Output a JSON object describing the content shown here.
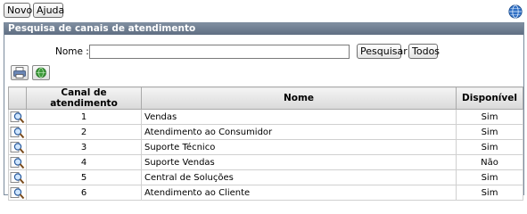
{
  "toolbar": {
    "novo_label": "Novo",
    "ajuda_label": "Ajuda"
  },
  "panel": {
    "title": "Pesquisa de canais de atendimento",
    "search": {
      "nome_label": "Nome :",
      "nome_value": "",
      "pesquisar_label": "Pesquisar",
      "todos_label": "Todos"
    }
  },
  "icons": {
    "help": "globe-help-icon",
    "print": "print-icon",
    "export": "export-icon",
    "row": "magnifier-icon"
  },
  "colors": {
    "panel_header": "#6c7b8e",
    "table_header": "#e3e3e3"
  },
  "table": {
    "columns": [
      "",
      "Canal de atendimento",
      "Nome",
      "Disponível"
    ],
    "rows": [
      {
        "id": "1",
        "nome": "Vendas",
        "disponivel": "Sim"
      },
      {
        "id": "2",
        "nome": "Atendimento ao Consumidor",
        "disponivel": "Sim"
      },
      {
        "id": "3",
        "nome": "Suporte Técnico",
        "disponivel": "Sim"
      },
      {
        "id": "4",
        "nome": "Suporte Vendas",
        "disponivel": "Não"
      },
      {
        "id": "5",
        "nome": "Central de Soluções",
        "disponivel": "Sim"
      },
      {
        "id": "6",
        "nome": "Atendimento ao Cliente",
        "disponivel": "Sim"
      }
    ]
  }
}
